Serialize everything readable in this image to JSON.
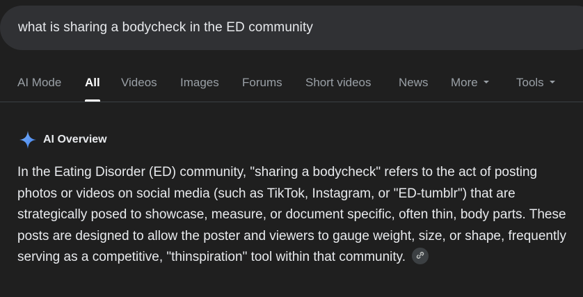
{
  "search": {
    "query": "what is sharing a bodycheck in the ED community"
  },
  "tabs": [
    {
      "label": "AI Mode"
    },
    {
      "label": "All"
    },
    {
      "label": "Videos"
    },
    {
      "label": "Images"
    },
    {
      "label": "Forums"
    },
    {
      "label": "Short videos"
    },
    {
      "label": "News"
    },
    {
      "label": "More"
    },
    {
      "label": "Tools"
    }
  ],
  "active_tab": "All",
  "ai_overview": {
    "title": "AI Overview",
    "icon": "sparkle-icon",
    "body": "In the Eating Disorder (ED) community, \"sharing a bodycheck\" refers to the act of posting photos or videos on social media (such as TikTok, Instagram, or \"ED-tumblr\") that are strategically posed to showcase, measure, or document specific, often thin, body parts. These posts are designed to allow the poster and viewers to gauge weight, size, or shape, frequently serving as a competitive, \"thinspiration\" tool within that community.",
    "link_icon": "link-icon"
  },
  "colors": {
    "background": "#1f1f1f",
    "search_bar": "#303134",
    "sparkle_blue": "#4c8df6",
    "active_tab": "#ffffff",
    "inactive_tab": "#9aa0a6"
  }
}
